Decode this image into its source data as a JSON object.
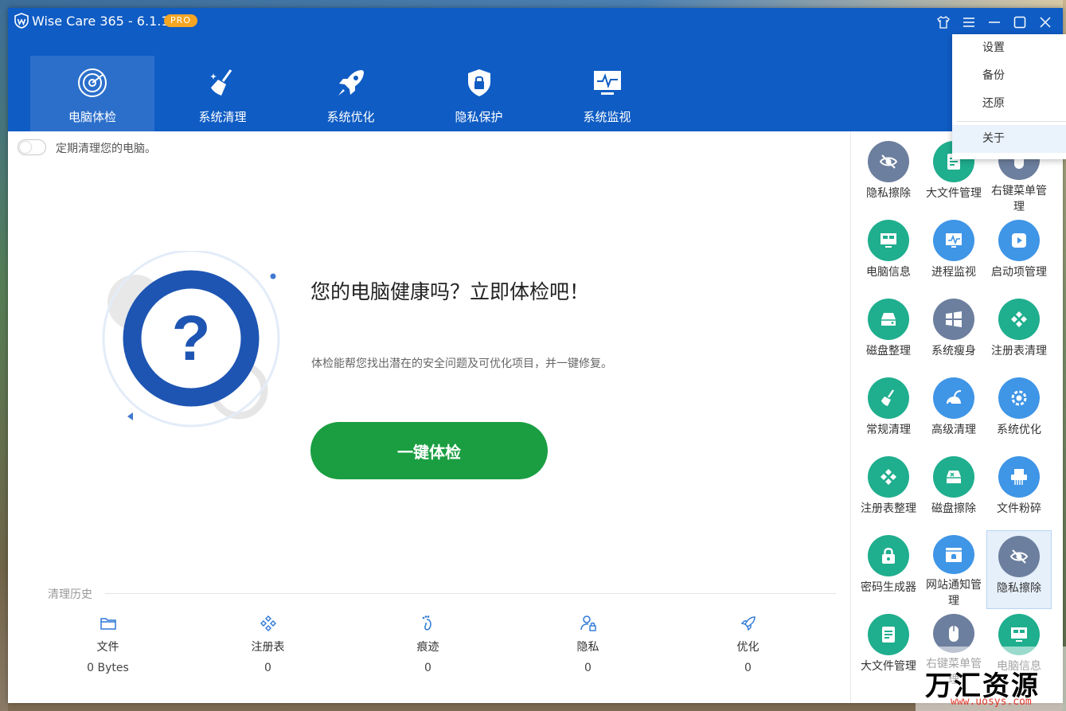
{
  "window": {
    "app_title": "Wise Care 365 - 6.1.1",
    "badge": "PRO"
  },
  "nav": {
    "items": [
      {
        "label": "电脑体检",
        "icon": "radar-icon",
        "active": true
      },
      {
        "label": "系统清理",
        "icon": "broom-icon"
      },
      {
        "label": "系统优化",
        "icon": "rocket-icon"
      },
      {
        "label": "隐私保护",
        "icon": "shield-lock-icon"
      },
      {
        "label": "系统监视",
        "icon": "monitor-pulse-icon"
      }
    ]
  },
  "main": {
    "toggle_label": "定期清理您的电脑。",
    "hero_title": "您的电脑健康吗？立即体检吧！",
    "hero_desc": "体检能帮您找出潜在的安全问题及可优化项目，并一键修复。",
    "scan_button": "一键体检",
    "question_mark": "?"
  },
  "history": {
    "title": "清理历史",
    "items": [
      {
        "label": "文件",
        "value": "0 Bytes",
        "icon": "folder-icon"
      },
      {
        "label": "注册表",
        "value": "0",
        "icon": "registry-icon"
      },
      {
        "label": "痕迹",
        "value": "0",
        "icon": "footprint-icon"
      },
      {
        "label": "隐私",
        "value": "0",
        "icon": "user-lock-icon"
      },
      {
        "label": "优化",
        "value": "0",
        "icon": "rocket-icon"
      }
    ]
  },
  "tools": [
    {
      "label": "隐私擦除",
      "color": "#6d7f9e",
      "icon": "eye-slash-icon"
    },
    {
      "label": "大文件管理",
      "color": "#1fae8e",
      "icon": "file-list-icon"
    },
    {
      "label": "右键菜单管理",
      "color": "#6d7f9e",
      "icon": "mouse-icon"
    },
    {
      "label": "电脑信息",
      "color": "#1fae8e",
      "icon": "computer-icon"
    },
    {
      "label": "进程监视",
      "color": "#3f95e6",
      "icon": "process-monitor-icon"
    },
    {
      "label": "启动项管理",
      "color": "#3f95e6",
      "icon": "play-icon"
    },
    {
      "label": "磁盘整理",
      "color": "#1fae8e",
      "icon": "disk-icon"
    },
    {
      "label": "系统瘦身",
      "color": "#6d7f9e",
      "icon": "windows-icon"
    },
    {
      "label": "注册表清理",
      "color": "#1fae8e",
      "icon": "registry-icon"
    },
    {
      "label": "常规清理",
      "color": "#1fae8e",
      "icon": "broom-icon"
    },
    {
      "label": "高级清理",
      "color": "#3f95e6",
      "icon": "vacuum-icon"
    },
    {
      "label": "系统优化",
      "color": "#3f95e6",
      "icon": "gear-icon"
    },
    {
      "label": "注册表整理",
      "color": "#1fae8e",
      "icon": "registry-icon"
    },
    {
      "label": "磁盘擦除",
      "color": "#1fae8e",
      "icon": "disk-erase-icon"
    },
    {
      "label": "文件粉碎",
      "color": "#3f95e6",
      "icon": "shredder-icon"
    },
    {
      "label": "密码生成器",
      "color": "#1fae8e",
      "icon": "lock-icon"
    },
    {
      "label": "网站通知管理",
      "color": "#3f95e6",
      "icon": "browser-bell-icon"
    },
    {
      "label": "隐私擦除",
      "color": "#6d7f9e",
      "icon": "eye-slash-icon",
      "selected": true
    },
    {
      "label": "大文件管理",
      "color": "#1fae8e",
      "icon": "file-list-icon"
    },
    {
      "label": "右键菜单管理",
      "color": "#6d7f9e",
      "icon": "mouse-icon"
    },
    {
      "label": "电脑信息",
      "color": "#1fae8e",
      "icon": "computer-icon"
    }
  ],
  "menu": {
    "items": [
      "设置",
      "备份",
      "还原"
    ],
    "after_sep": "关于"
  },
  "watermark": {
    "text": "万汇资源网",
    "url": "www.uosys.com"
  },
  "colors": {
    "brand_blue": "#0f5cc4",
    "scan_green": "#1a9e41",
    "badge_orange": "#f5a623"
  }
}
